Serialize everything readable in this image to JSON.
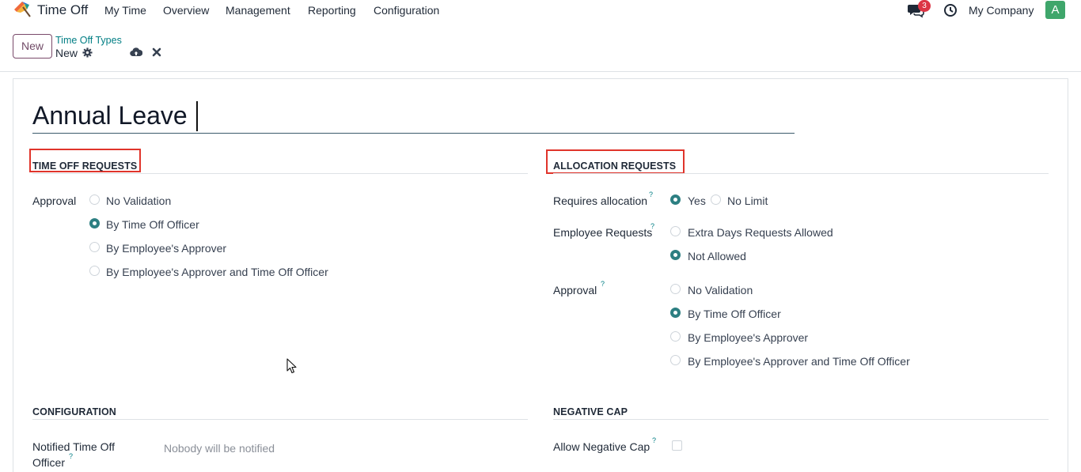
{
  "nav": {
    "app_title": "Time Off",
    "menu": [
      "My Time",
      "Overview",
      "Management",
      "Reporting",
      "Configuration"
    ],
    "messages_badge": "3",
    "company": "My Company",
    "avatar_letter": "A"
  },
  "control": {
    "new_label": "New",
    "breadcrumb_parent": "Time Off Types",
    "breadcrumb_current": "New"
  },
  "record": {
    "name": "Annual Leave"
  },
  "time_off_requests": {
    "title": "TIME OFF REQUESTS",
    "approval_label": "Approval",
    "options": [
      "No Validation",
      "By Time Off Officer",
      "By Employee's Approver",
      "By Employee's Approver and Time Off Officer"
    ],
    "selected": "By Time Off Officer"
  },
  "allocation_requests": {
    "title": "ALLOCATION REQUESTS",
    "requires_label": "Requires allocation",
    "requires_options": [
      "Yes",
      "No Limit"
    ],
    "requires_selected": "Yes",
    "employee_requests_label": "Employee Requests",
    "employee_requests_options": [
      "Extra Days Requests Allowed",
      "Not Allowed"
    ],
    "employee_requests_selected": "Not Allowed",
    "approval_label": "Approval",
    "approval_options": [
      "No Validation",
      "By Time Off Officer",
      "By Employee's Approver",
      "By Employee's Approver and Time Off Officer"
    ],
    "approval_selected": "By Time Off Officer"
  },
  "configuration": {
    "title": "CONFIGURATION",
    "notified_label_line1": "Notified Time Off",
    "notified_label_line2": "Officer",
    "notified_placeholder": "Nobody will be notified"
  },
  "negative_cap": {
    "title": "NEGATIVE CAP",
    "allow_label": "Allow Negative Cap",
    "allow_checked": false
  },
  "help_mark": "?",
  "colors": {
    "brand": "#714b67",
    "accent": "#017e84",
    "radio_checked": "#2d7f82",
    "highlight_box": "#e0342b"
  }
}
